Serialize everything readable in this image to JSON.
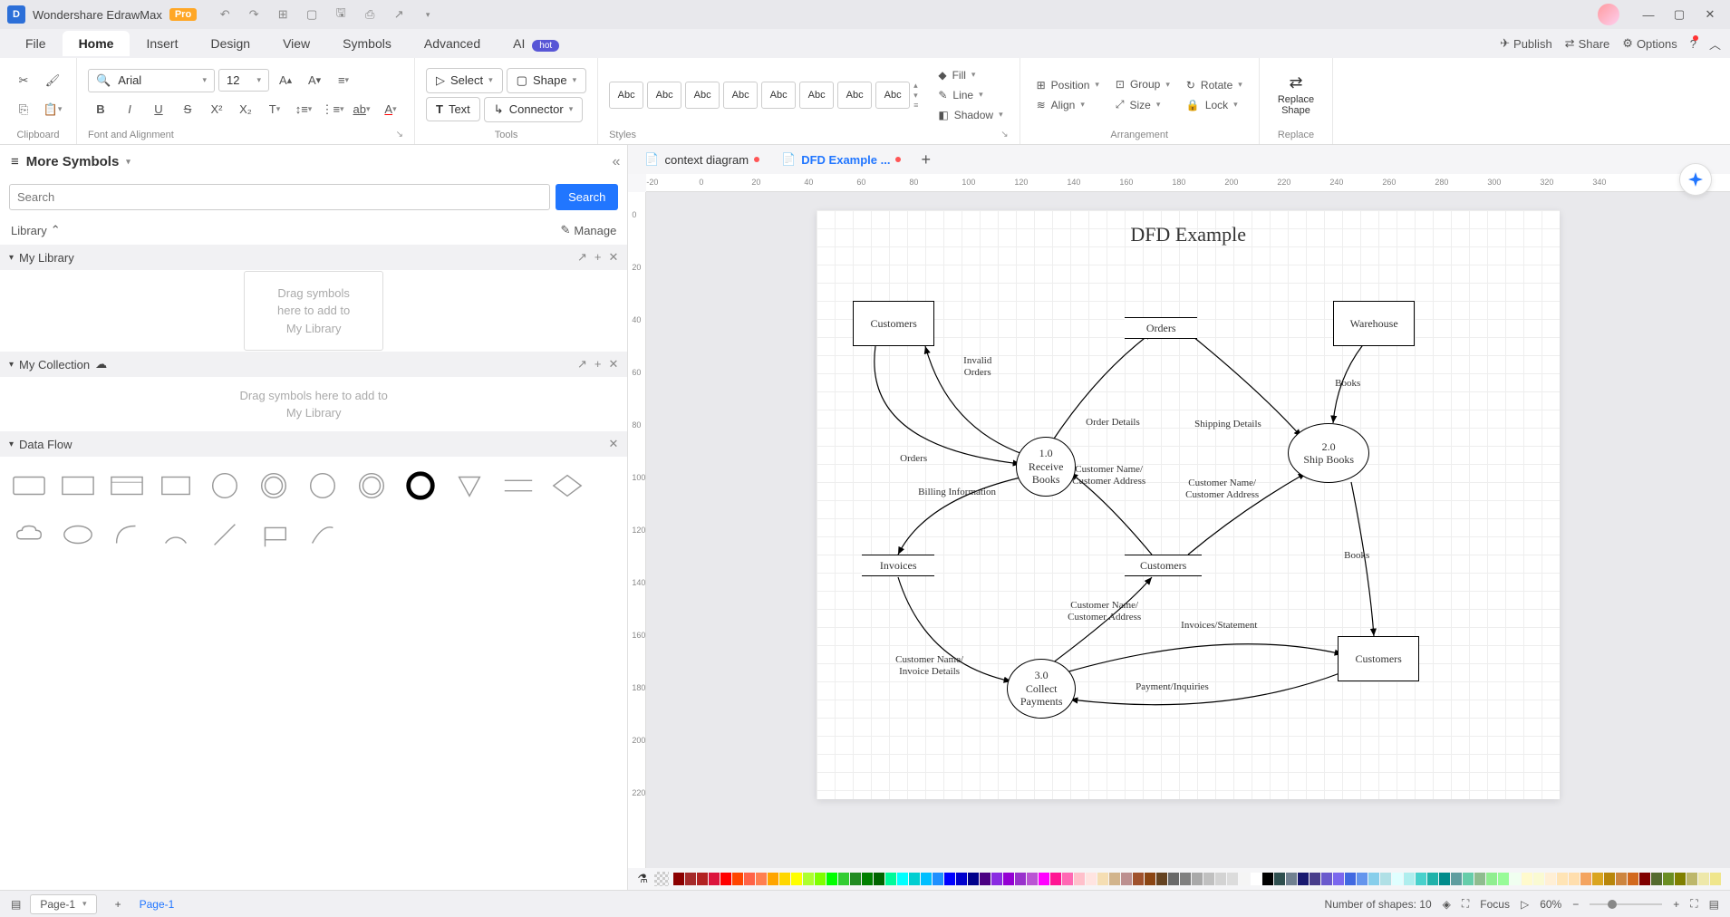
{
  "app": {
    "name": "Wondershare EdrawMax",
    "badge": "Pro"
  },
  "menu": {
    "file": "File",
    "home": "Home",
    "insert": "Insert",
    "design": "Design",
    "view": "View",
    "symbols": "Symbols",
    "advanced": "Advanced",
    "ai": "AI",
    "ai_badge": "hot",
    "publish": "Publish",
    "share": "Share",
    "options": "Options"
  },
  "ribbon": {
    "clipboard_label": "Clipboard",
    "font_label": "Font and Alignment",
    "tools_label": "Tools",
    "styles_label": "Styles",
    "arrangement_label": "Arrangement",
    "replace_label": "Replace",
    "font_name": "Arial",
    "font_size": "12",
    "select": "Select",
    "shape": "Shape",
    "text": "Text",
    "connector": "Connector",
    "style_sample": "Abc",
    "fill": "Fill",
    "line": "Line",
    "shadow": "Shadow",
    "position": "Position",
    "align": "Align",
    "group": "Group",
    "size": "Size",
    "rotate": "Rotate",
    "lock": "Lock",
    "replace_shape": "Replace\nShape"
  },
  "panel": {
    "title": "More Symbols",
    "search_placeholder": "Search",
    "search_btn": "Search",
    "library": "Library",
    "manage": "Manage",
    "my_library": "My Library",
    "my_collection": "My Collection",
    "data_flow": "Data Flow",
    "drop_text1": "Drag symbols\nhere to add to\nMy Library",
    "drop_text2": "Drag symbols here to add to\nMy Library"
  },
  "tabs": {
    "tab1": "context diagram",
    "tab2": "DFD Example ..."
  },
  "diagram": {
    "title": "DFD Example",
    "customers": "Customers",
    "warehouse": "Warehouse",
    "orders": "Orders",
    "invoices": "Invoices",
    "customers_ds": "Customers",
    "customers_right": "Customers",
    "p1": "1.0\nReceive\nBooks",
    "p2": "2.0\nShip Books",
    "p3": "3.0\nCollect\nPayments",
    "invalid_orders": "Invalid\nOrders",
    "orders_flow": "Orders",
    "order_details": "Order Details",
    "shipping_details": "Shipping Details",
    "books1": "Books",
    "books2": "Books",
    "billing_info": "Billing Information",
    "cust_name_addr1": "Customer Name/\nCustomer Address",
    "cust_name_addr2": "Customer Name/\nCustomer Address",
    "cust_name_addr3": "Customer Name/\nCustomer Address",
    "cust_invoice": "Customer Name/\nInvoice Details",
    "invoices_stmt": "Invoices/Statement",
    "payment_inq": "Payment/Inquiries"
  },
  "status": {
    "page_select": "Page-1",
    "page_tab": "Page-1",
    "shapes_count": "Number of shapes: 10",
    "focus": "Focus",
    "zoom": "60%"
  },
  "ruler_h": [
    "-20",
    "0",
    "20",
    "40",
    "60",
    "80",
    "100",
    "120",
    "140",
    "160",
    "180",
    "200",
    "220",
    "240",
    "260",
    "280",
    "300",
    "320",
    "340"
  ],
  "ruler_v": [
    "0",
    "20",
    "40",
    "60",
    "80",
    "100",
    "120",
    "140",
    "160",
    "180",
    "200",
    "220"
  ]
}
